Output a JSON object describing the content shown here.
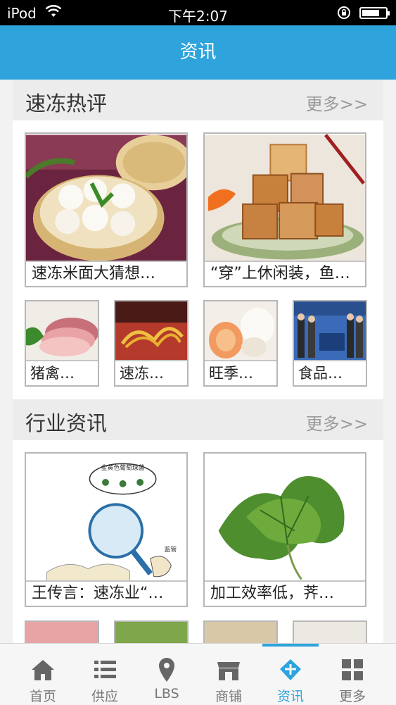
{
  "statusbar": {
    "carrier": "iPod",
    "time": "下午2:07"
  },
  "navbar": {
    "title": "资讯"
  },
  "sections": [
    {
      "title": "速冻热评",
      "more": "更多>>",
      "big_cards": [
        {
          "caption": "速冻米面大猜想…"
        },
        {
          "caption": "“穿”上休闲装，鱼…"
        }
      ],
      "small_cards": [
        {
          "caption": "猪禽…"
        },
        {
          "caption": "速冻…"
        },
        {
          "caption": "旺季…"
        },
        {
          "caption": "食品…"
        }
      ]
    },
    {
      "title": "行业资讯",
      "more": "更多>>",
      "big_cards": [
        {
          "caption": "王传言：速冻业“…",
          "image_text_top": "金黄色葡萄球菌",
          "image_text_bottom": "监管"
        },
        {
          "caption": "加工效率低，荠…"
        }
      ]
    }
  ],
  "tabbar": {
    "items": [
      {
        "label": "首页",
        "icon": "home-icon"
      },
      {
        "label": "供应",
        "icon": "list-icon"
      },
      {
        "label": "LBS",
        "icon": "location-pin-icon"
      },
      {
        "label": "商铺",
        "icon": "shop-icon"
      },
      {
        "label": "资讯",
        "icon": "news-icon",
        "active": true
      },
      {
        "label": "更多",
        "icon": "grid-icon"
      }
    ]
  },
  "colors": {
    "accent": "#2ea3dc",
    "section_header": "#ececec",
    "background": "#f2f2f2"
  }
}
